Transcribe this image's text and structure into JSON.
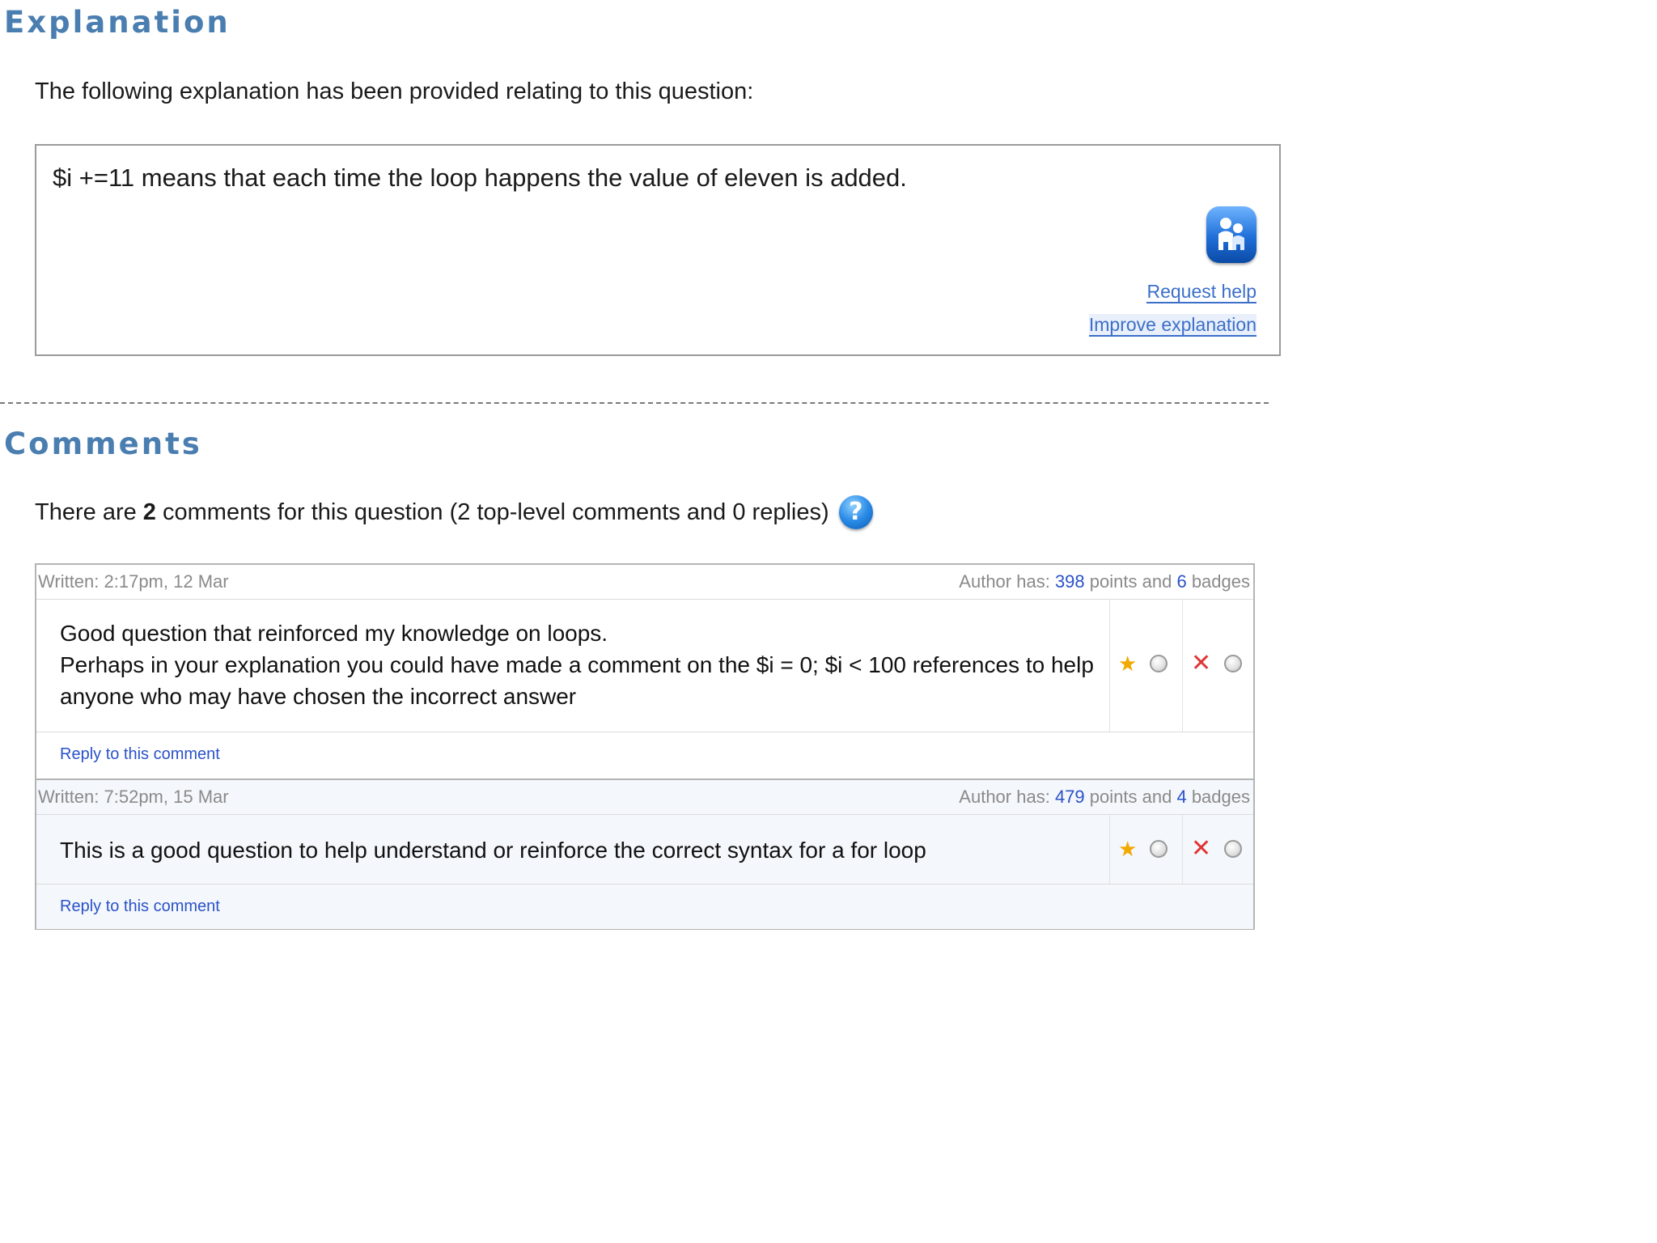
{
  "explanation": {
    "heading": "Explanation",
    "intro": "The following explanation has been provided relating to this question:",
    "text": "$i +=11 means that each time the loop happens the value of eleven is added.",
    "request_help": "Request help",
    "improve_explanation": "Improve explanation",
    "help_icon": "help-person-icon"
  },
  "comments": {
    "heading": "Comments",
    "summary": {
      "prefix": "There are",
      "count": "2",
      "suffix": "comments for this question (2 top-level comments and 0 replies)",
      "info_icon": "question-mark-icon"
    },
    "items": [
      {
        "written": "Written: 2:17pm, 12 Mar",
        "author_prefix": "Author has:",
        "points": "398",
        "points_label": "points and",
        "badges": "6",
        "badges_label": "badges",
        "lines": [
          "Good question that reinforced my knowledge on loops.",
          "Perhaps in your explanation you could have made a comment on the $i = 0; $i < 100 references to help",
          "anyone who may have chosen the incorrect answer"
        ],
        "reply": "Reply to this comment"
      },
      {
        "written": "Written: 7:52pm, 15 Mar",
        "author_prefix": "Author has:",
        "points": "479",
        "points_label": "points and",
        "badges": "4",
        "badges_label": "badges",
        "lines": [
          "This is a good question to help understand or reinforce the correct syntax for a for loop"
        ],
        "reply": "Reply to this comment"
      }
    ],
    "vote_icons": {
      "endorse": "star-icon",
      "reject": "x-icon",
      "select": "radio-button"
    }
  },
  "colors": {
    "heading": "#4a7eb1",
    "link": "#3b6fc9",
    "number": "#2a52c9",
    "star": "#f2a900",
    "reject": "#e03535"
  }
}
